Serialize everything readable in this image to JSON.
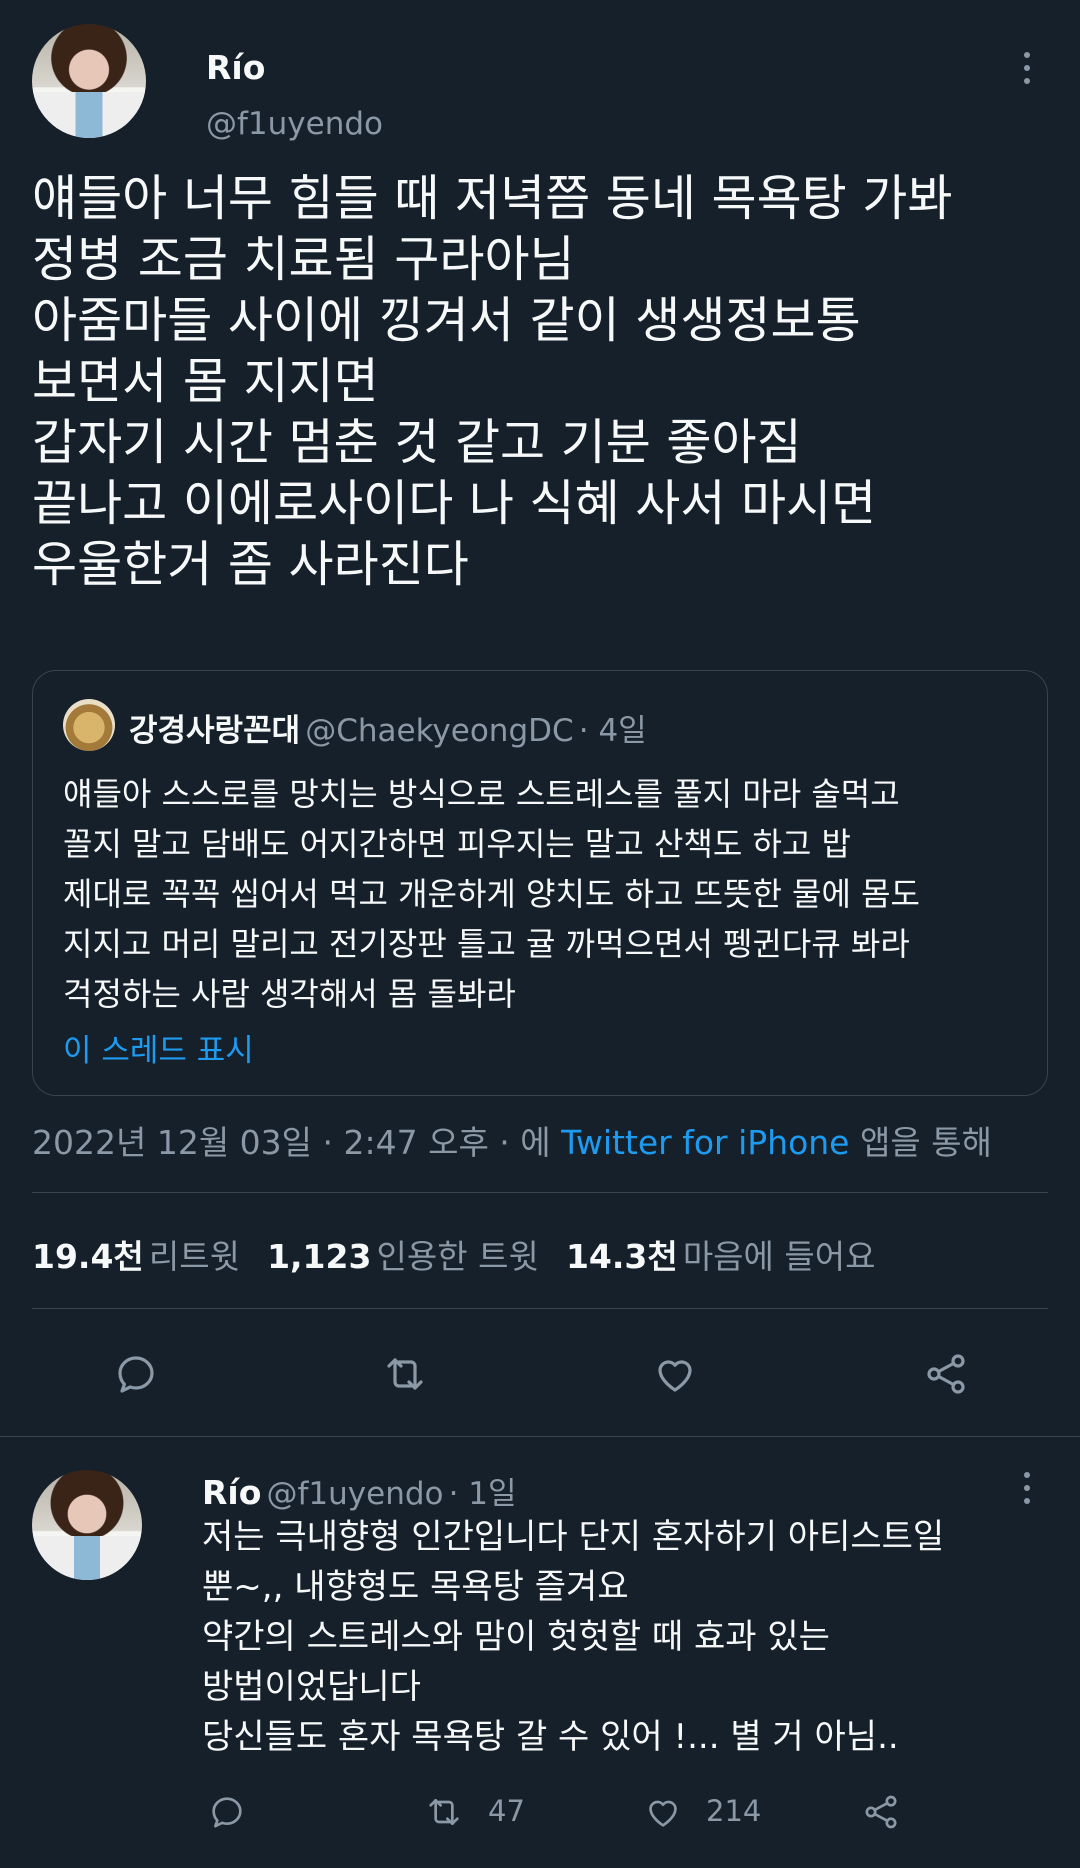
{
  "tweet": {
    "author_name": "Río",
    "author_handle": "@f1uyendo",
    "text": "얘들아 너무 힘들 때 저녁쯤 동네 목욕탕 가봐\n정병 조금 치료됨 구라아님\n아줌마들 사이에 낑겨서 같이 생생정보통\n보면서 몸 지지면\n갑자기 시간 멈춘 것 같고 기분 좋아짐\n끝나고 이에로사이다 나 식혜 사서 마시면\n우울한거 좀 사라진다",
    "quoted": {
      "author_name": "강경사랑꼰대",
      "author_handle": "@ChaekyeongDC",
      "time": "· 4일",
      "text": "얘들아 스스로를 망치는 방식으로 스트레스를 풀지 마라 술먹고\n꼴지 말고 담배도 어지간하면 피우지는 말고 산책도 하고 밥\n제대로 꼭꼭 씹어서 먹고 개운하게 양치도 하고 뜨뜻한 물에 몸도\n지지고 머리 말리고 전기장판 틀고 귤 까먹으면서 펭귄다큐 봐라\n걱정하는 사람 생각해서 몸 돌봐라",
      "show_thread": "이 스레드 표시"
    },
    "timestamp": "2022년 12월 03일 · 2:47 오후 · 에",
    "source": "Twitter for iPhone",
    "source_suffix": "앱을 통해",
    "stats": {
      "retweets_num": "19.4천",
      "retweets_label": "리트윗",
      "quotes_num": "1,123",
      "quotes_label": "인용한 트윗",
      "likes_num": "14.3천",
      "likes_label": "마음에 들어요"
    }
  },
  "reply": {
    "author_name": "Río",
    "author_handle": "@f1uyendo",
    "time": "· 1일",
    "text": "저는 극내향형 인간입니다 단지 혼자하기 아티스트일\n뿐~,, 내향형도 목욕탕 즐겨요\n약간의 스트레스와 맘이 헛헛할 때 효과 있는\n방법이었답니다\n당신들도 혼자 목욕탕 갈 수 있어 !... 별 거 아님..",
    "retweet_count": "47",
    "like_count": "214"
  },
  "colors": {
    "background": "#15202b",
    "text": "#f7f9f9",
    "secondary": "#8b98a5",
    "accent": "#1d9bf0",
    "border": "#38444d"
  },
  "icons": [
    "reply-icon",
    "retweet-icon",
    "like-icon",
    "share-icon",
    "more-icon"
  ]
}
